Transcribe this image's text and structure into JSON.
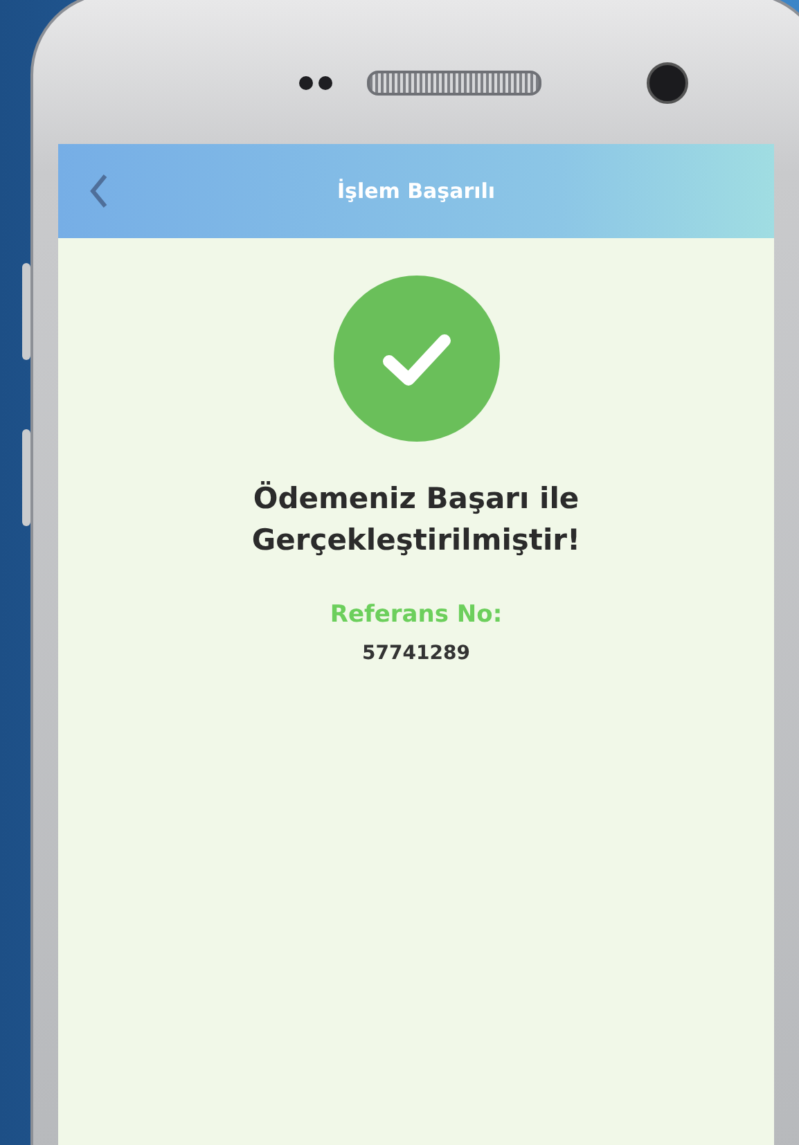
{
  "header": {
    "title": "İşlem Başarılı"
  },
  "message": "Ödemeniz Başarı ile Gerçekleştirilmiştir!",
  "reference": {
    "label": "Referans No:",
    "value": "57741289"
  }
}
